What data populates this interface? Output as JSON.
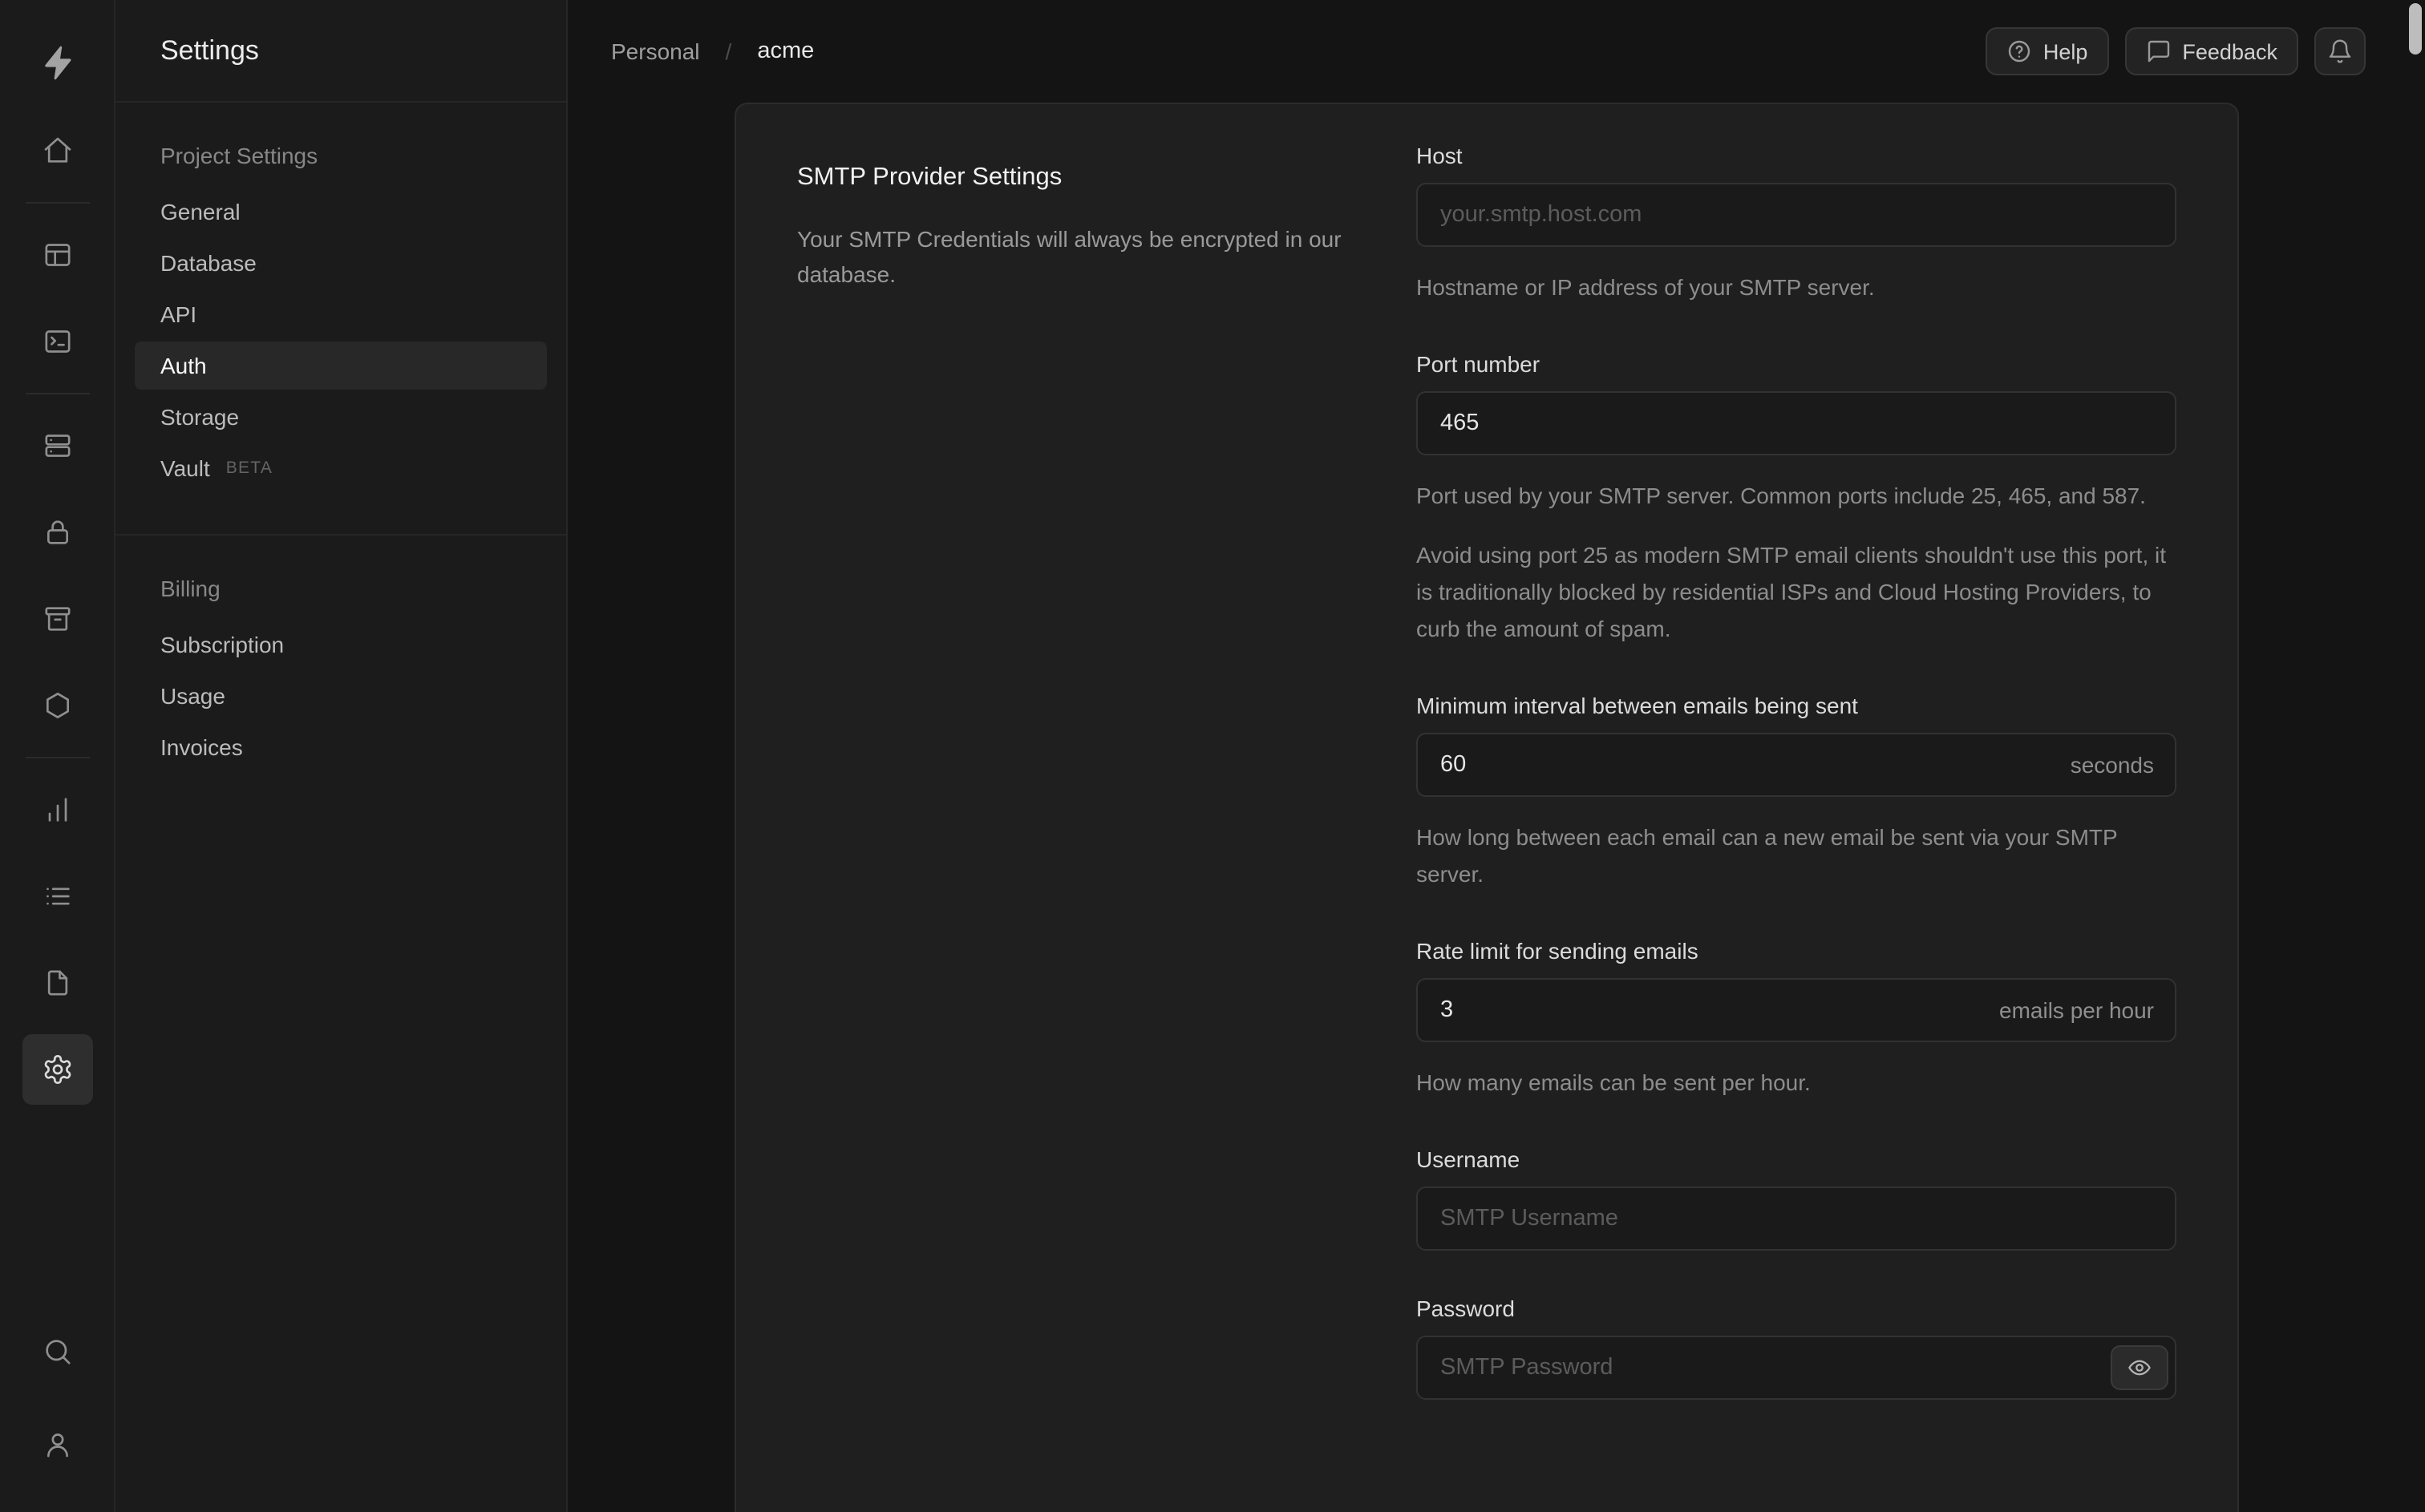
{
  "rail": {
    "icons": [
      "supabase-logo",
      "home-icon",
      "table-editor-icon",
      "sql-editor-icon",
      "database-icon",
      "auth-lock-icon",
      "storage-icon",
      "edge-functions-icon",
      "reports-icon",
      "logs-icon",
      "docs-icon",
      "settings-gear-icon",
      "search-icon",
      "account-icon"
    ]
  },
  "sidebar": {
    "title": "Settings",
    "sections": [
      {
        "header": "Project Settings",
        "items": [
          {
            "label": "General"
          },
          {
            "label": "Database"
          },
          {
            "label": "API"
          },
          {
            "label": "Auth",
            "active": true
          },
          {
            "label": "Storage"
          },
          {
            "label": "Vault",
            "badge": "BETA"
          }
        ]
      },
      {
        "header": "Billing",
        "items": [
          {
            "label": "Subscription"
          },
          {
            "label": "Usage"
          },
          {
            "label": "Invoices"
          }
        ]
      }
    ]
  },
  "topbar": {
    "breadcrumb": [
      {
        "label": "Personal"
      },
      {
        "label": "acme"
      }
    ],
    "separator": "/",
    "help_label": "Help",
    "feedback_label": "Feedback",
    "icons": [
      "help-circle-icon",
      "feedback-bubble-icon",
      "notifications-bell-icon"
    ]
  },
  "content": {
    "title": "SMTP Provider Settings",
    "description": "Your SMTP Credentials will always be encrypted in our database.",
    "fields": {
      "host": {
        "label": "Host",
        "placeholder": "your.smtp.host.com",
        "help": "Hostname or IP address of your SMTP server."
      },
      "port": {
        "label": "Port number",
        "value": "465",
        "help": "Port used by your SMTP server. Common ports include 25, 465, and 587.",
        "note": "Avoid using port 25 as modern SMTP email clients shouldn't use this port, it is traditionally blocked by residential ISPs and Cloud Hosting Providers, to curb the amount of spam."
      },
      "min_interval": {
        "label": "Minimum interval between emails being sent",
        "value": "60",
        "unit": "seconds",
        "help": "How long between each email can a new email be sent via your SMTP server."
      },
      "rate_limit": {
        "label": "Rate limit for sending emails",
        "value": "3",
        "unit": "emails per hour",
        "help": "How many emails can be sent per hour."
      },
      "username": {
        "label": "Username",
        "placeholder": "SMTP Username"
      },
      "password": {
        "label": "Password",
        "placeholder": "SMTP Password"
      }
    }
  }
}
